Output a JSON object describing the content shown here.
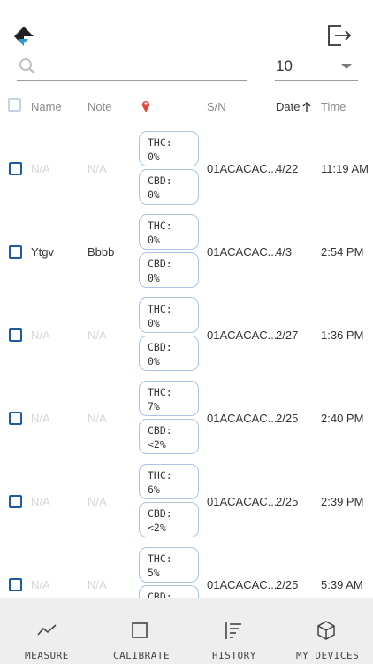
{
  "search": {
    "placeholder": "",
    "value": ""
  },
  "page_size": {
    "selected": "10"
  },
  "columns": {
    "name": "Name",
    "note": "Note",
    "sn": "S/N",
    "date": "Date",
    "time": "Time"
  },
  "rows": [
    {
      "name": "N/A",
      "note": "N/A",
      "thc": "THC:",
      "thc_value": "0%",
      "cbd": "CBD:",
      "cbd_value": "0%",
      "sn": "01ACACAC...",
      "date": "4/22",
      "time": "11:19 AM"
    },
    {
      "name": "Ytgv",
      "note": "Bbbb",
      "thc": "THC:",
      "thc_value": "0%",
      "cbd": "CBD:",
      "cbd_value": "0%",
      "sn": "01ACACAC...",
      "date": "4/3",
      "time": "2:54 PM"
    },
    {
      "name": "N/A",
      "note": "N/A",
      "thc": "THC:",
      "thc_value": "0%",
      "cbd": "CBD:",
      "cbd_value": "0%",
      "sn": "01ACACAC...",
      "date": "2/27",
      "time": "1:36 PM"
    },
    {
      "name": "N/A",
      "note": "N/A",
      "thc": "THC:",
      "thc_value": "7%",
      "cbd": "CBD:",
      "cbd_value": "<2%",
      "sn": "01ACACAC...",
      "date": "2/25",
      "time": "2:40 PM"
    },
    {
      "name": "N/A",
      "note": "N/A",
      "thc": "THC:",
      "thc_value": "6%",
      "cbd": "CBD:",
      "cbd_value": "<2%",
      "sn": "01ACACAC...",
      "date": "2/25",
      "time": "2:39 PM"
    },
    {
      "name": "N/A",
      "note": "N/A",
      "thc": "THC:",
      "thc_value": "5%",
      "cbd": "CBD:",
      "cbd_value": "",
      "sn": "01ACACAC...",
      "date": "2/25",
      "time": "5:39 AM"
    }
  ],
  "bottom_nav": [
    {
      "label": "MEASURE",
      "icon": "chart-line-icon"
    },
    {
      "label": "CALIBRATE",
      "icon": "square-icon"
    },
    {
      "label": "HISTORY",
      "icon": "history-list-icon"
    },
    {
      "label": "MY DEVICES",
      "icon": "cube-icon"
    }
  ],
  "colors": {
    "accent": "#1e5aa8",
    "chip_border": "#a9c5e3",
    "nav_bg": "#eeeeee"
  }
}
